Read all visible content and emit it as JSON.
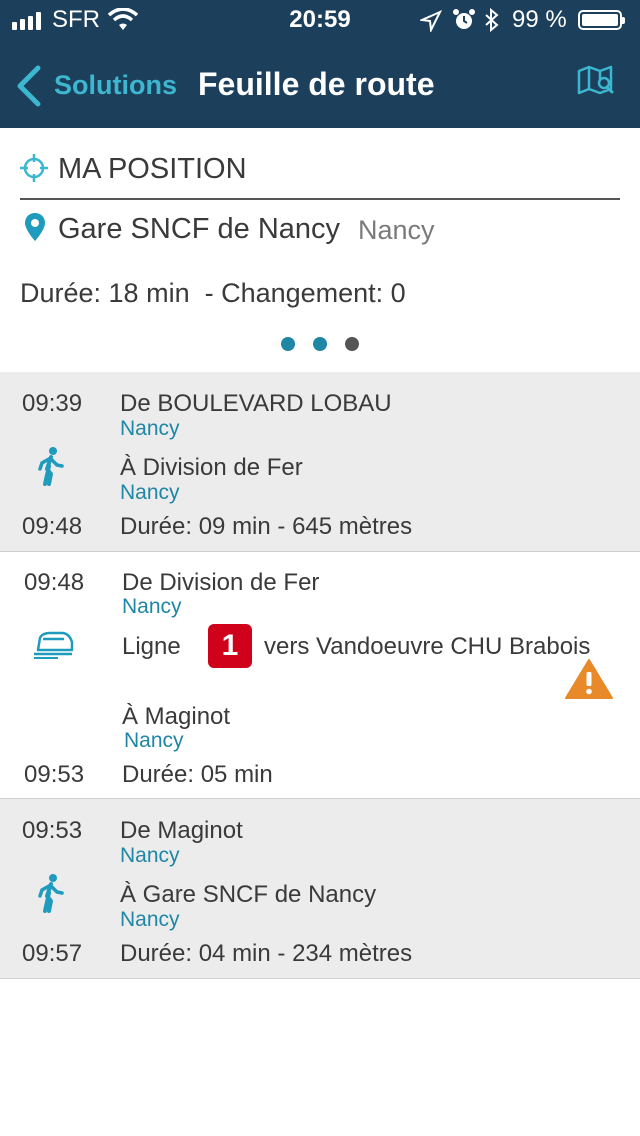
{
  "status_bar": {
    "carrier": "SFR",
    "time": "20:59",
    "battery": "99 %"
  },
  "nav": {
    "back_label": "Solutions",
    "title": "Feuille de route"
  },
  "summary": {
    "origin": "MA POSITION",
    "destination_name": "Gare SNCF de Nancy",
    "destination_city": "Nancy",
    "duration_text": "Durée: 18 min  - Changement: 0"
  },
  "steps": [
    {
      "mode": "walk",
      "start_time": "09:39",
      "from": "De BOULEVARD LOBAU",
      "from_city": "Nancy",
      "to": "À Division de Fer",
      "to_city": "Nancy",
      "end_time": "09:48",
      "duration": "Durée: 09 min - 645 mètres"
    },
    {
      "mode": "tram",
      "start_time": "09:48",
      "from": "De Division de Fer",
      "from_city": "Nancy",
      "line_label": "Ligne",
      "line_number": "1",
      "line_direction": "vers Vandoeuvre CHU Brabois",
      "to": "À Maginot",
      "to_city": "Nancy",
      "end_time": "09:53",
      "duration": "Durée: 05 min"
    },
    {
      "mode": "walk",
      "start_time": "09:53",
      "from": "De Maginot",
      "from_city": "Nancy",
      "to": "À Gare SNCF de Nancy",
      "to_city": "Nancy",
      "end_time": "09:57",
      "duration": "Durée: 04 min - 234 mètres"
    }
  ],
  "colors": {
    "header_bg": "#1c3f5c",
    "accent": "#3cb7cf",
    "city_text": "#1f86a6",
    "line_badge": "#d0021b",
    "warning": "#e8892a"
  }
}
